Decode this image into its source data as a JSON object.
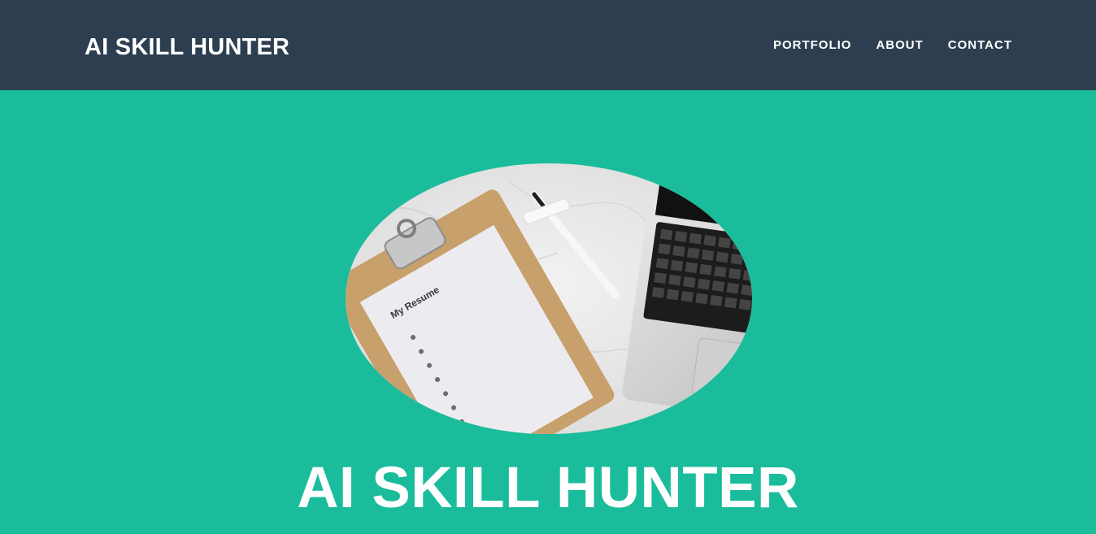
{
  "navbar": {
    "brand": "AI SKILL HUNTER",
    "links": [
      {
        "label": "PORTFOLIO"
      },
      {
        "label": "ABOUT"
      },
      {
        "label": "CONTACT"
      }
    ]
  },
  "masthead": {
    "image_alt": "Clipboard with resume, pen and laptop",
    "resume_title": "My Resume",
    "heading": "AI SKILL HUNTER"
  },
  "colors": {
    "navbar_bg": "#2c3e50",
    "masthead_bg": "#1abc9c",
    "text": "#ffffff"
  }
}
